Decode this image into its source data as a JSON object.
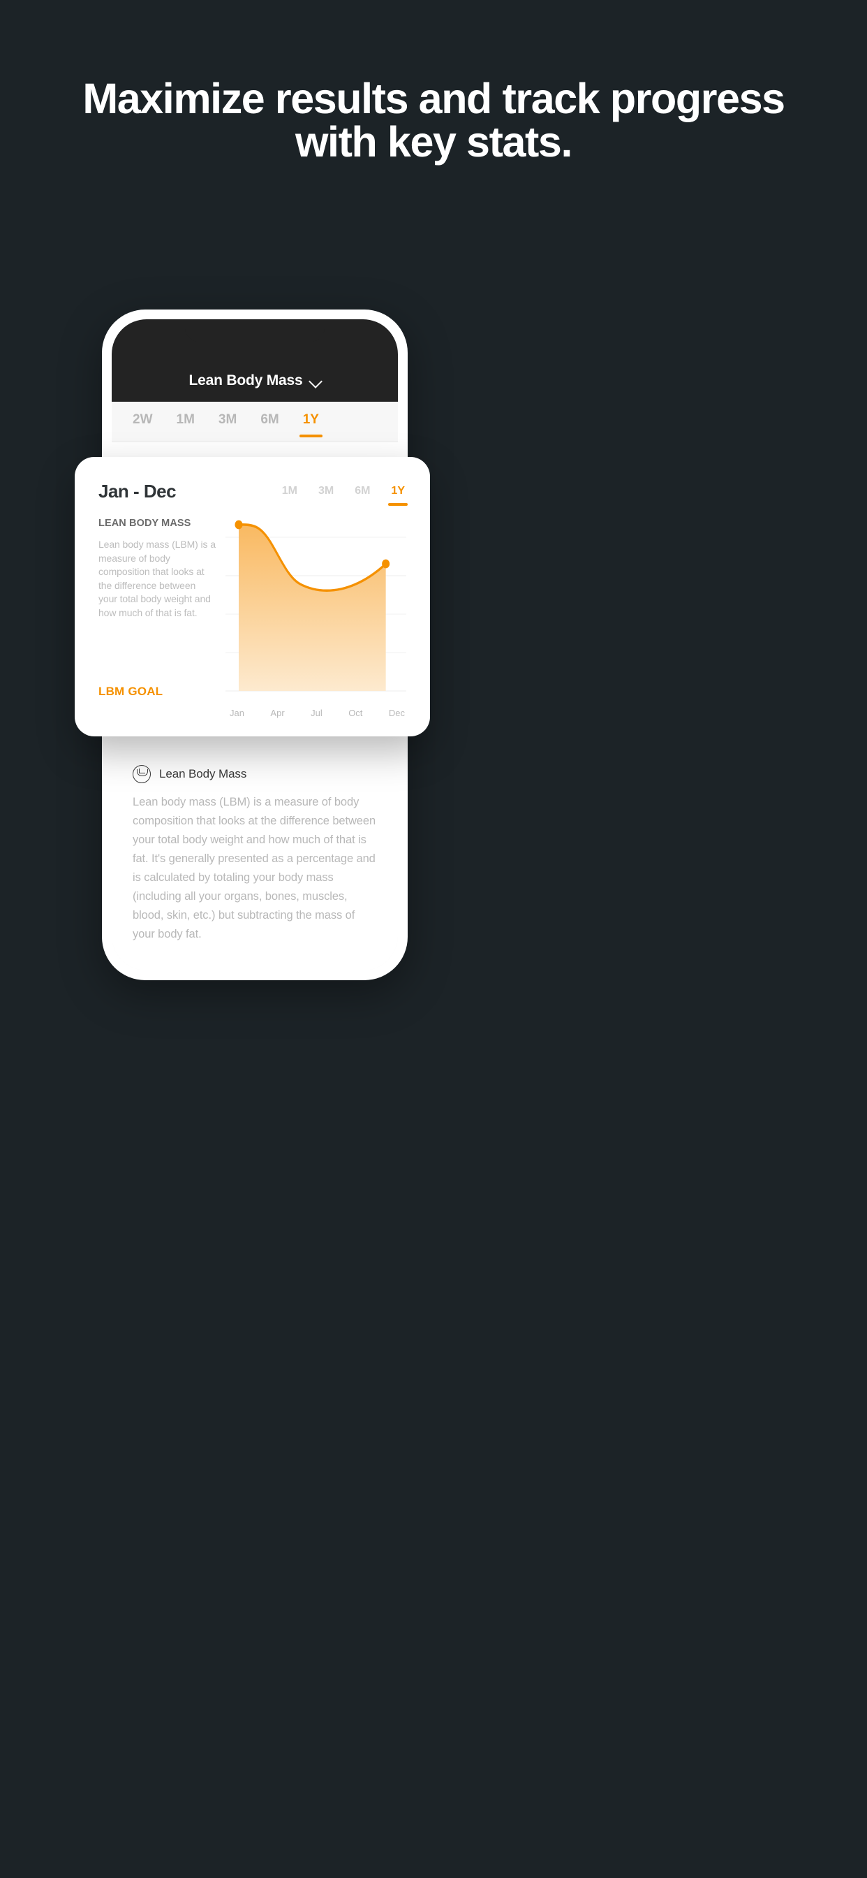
{
  "headline": "Maximize results and track progress with key stats.",
  "colors": {
    "background": "#1c2327",
    "accent": "#f59100",
    "nav_bar": "#232323",
    "card_bg": "#ffffff",
    "muted_text": "#bdbdbd"
  },
  "phone": {
    "nav": {
      "title": "Lean Body Mass",
      "chevron_icon": "chevron-down-icon"
    },
    "range_tabs": [
      {
        "label": "2W",
        "active": false
      },
      {
        "label": "1M",
        "active": false
      },
      {
        "label": "3M",
        "active": false
      },
      {
        "label": "6M",
        "active": false
      },
      {
        "label": "1Y",
        "active": true
      }
    ],
    "info": {
      "icon": "lean-body-mass-icon",
      "title": "Lean Body Mass",
      "paragraph": "Lean body mass (LBM) is a measure of body composition that looks at the difference between your total body weight and how much of that is fat. It's generally presented as a percentage and is calculated by totaling your body mass (including all your organs, bones, muscles, blood, skin, etc.) but subtracting the mass of your body fat."
    }
  },
  "card": {
    "title": "Jan - Dec",
    "tabs": [
      {
        "label": "1M",
        "active": false
      },
      {
        "label": "3M",
        "active": false
      },
      {
        "label": "6M",
        "active": false
      },
      {
        "label": "1Y",
        "active": true
      }
    ],
    "metric_label": "LEAN BODY MASS",
    "metric_description": "Lean body mass (LBM) is a measure of body composition that looks at the difference between your total body weight and how much of that is fat.",
    "goal_label": "LBM GOAL"
  },
  "chart_data": {
    "type": "area",
    "title": "Lean Body Mass",
    "xlabel": "",
    "ylabel": "",
    "grid": true,
    "legend_position": "none",
    "tick_labels": [
      "Jan",
      "Apr",
      "Jul",
      "Oct",
      "Dec"
    ],
    "gridline_count": 5,
    "line_color": "#f59100",
    "fill_top_color": "#f9b961",
    "fill_bottom_color": "#fdeacf",
    "marker_points": [
      "Jan",
      "Dec"
    ],
    "ylim": [
      60,
      100
    ],
    "x": [
      "Jan",
      "Feb",
      "Mar",
      "Apr",
      "May",
      "Jun",
      "Jul",
      "Aug",
      "Sep",
      "Oct",
      "Nov",
      "Dec"
    ],
    "values": [
      93,
      92.8,
      91.5,
      87.5,
      81,
      76,
      73.2,
      71.8,
      71.6,
      72.5,
      74.5,
      78
    ]
  }
}
